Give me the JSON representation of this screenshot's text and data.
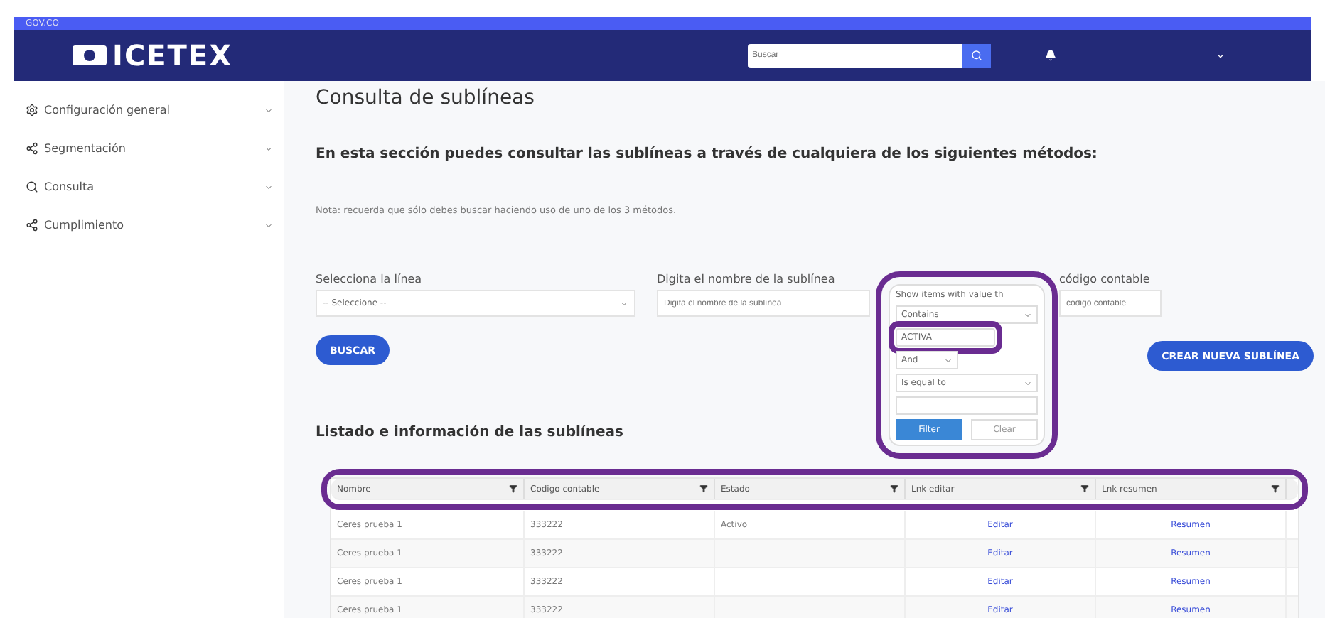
{
  "gov_bar": {
    "label": "GOV.CO"
  },
  "header": {
    "logo": "ICETEX",
    "search": {
      "placeholder": "Buscar"
    }
  },
  "sidebar": {
    "items": [
      {
        "label": "Configuración general"
      },
      {
        "label": "Segmentación"
      },
      {
        "label": "Consulta"
      },
      {
        "label": "Cumplimiento"
      }
    ]
  },
  "page": {
    "title": "Consulta de sublíneas",
    "intro": "En esta sección puedes consultar las sublíneas a través de cualquiera de los siguientes métodos:",
    "note": "Nota: recuerda que sólo debes buscar haciendo uso de uno de los 3 métodos."
  },
  "fields": [
    {
      "label": "Selecciona la línea",
      "kind": "select",
      "value": "-- Seleccione --"
    },
    {
      "label": "Digita el nombre de la sublínea",
      "kind": "text",
      "placeholder": "Digita el nombre de la sublínea"
    },
    {
      "label": "código contable",
      "kind": "text",
      "placeholder": "código contable"
    }
  ],
  "buttons": {
    "search": "BUSCAR",
    "create": "CREAR NUEVA SUBLÍNEA"
  },
  "filter_popup": {
    "title": "Show items with value th",
    "operator": "Contains",
    "value": "ACTIVA",
    "logic": "And",
    "operator_2": "Is equal to",
    "filter": "Filter",
    "clear": "Clear"
  },
  "list_title": "Listado e información de las sublíneas",
  "table": {
    "columns": [
      "Nombre",
      "Codigo contable",
      "Estado",
      "Lnk editar",
      "Lnk resumen"
    ],
    "rows": [
      [
        "Ceres prueba 1",
        "333222",
        "Activo",
        "Editar",
        "Resumen"
      ],
      [
        "Ceres prueba 1",
        "333222",
        "",
        "Editar",
        "Resumen"
      ],
      [
        "Ceres prueba 1",
        "333222",
        "",
        "Editar",
        "Resumen"
      ],
      [
        "Ceres prueba 1",
        "333222",
        "",
        "Editar",
        "Resumen"
      ]
    ]
  }
}
